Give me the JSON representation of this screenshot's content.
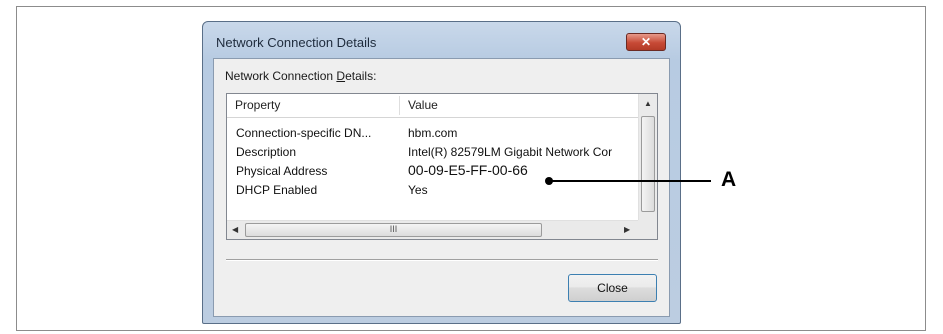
{
  "dialog": {
    "title": "Network Connection Details",
    "close_glyph": "✕",
    "list_label_pre": "Network Connection ",
    "list_label_u": "D",
    "list_label_post": "etails:",
    "columns": [
      "Property",
      "Value"
    ],
    "rows": [
      {
        "property": "Connection-specific DN...",
        "value": "hbm.com"
      },
      {
        "property": "Description",
        "value": "Intel(R) 82579LM Gigabit Network Cor"
      },
      {
        "property": "Physical Address",
        "value": "00-09-E5-FF-00-66"
      },
      {
        "property": "DHCP Enabled",
        "value": "Yes"
      }
    ],
    "hscroll_grip": "III",
    "close_button": "Close"
  },
  "annotation": {
    "label": "A"
  },
  "colors": {
    "title_bar": "#b7cbe2",
    "close_red": "#c74a36",
    "button_focus": "#3c7fb1"
  }
}
